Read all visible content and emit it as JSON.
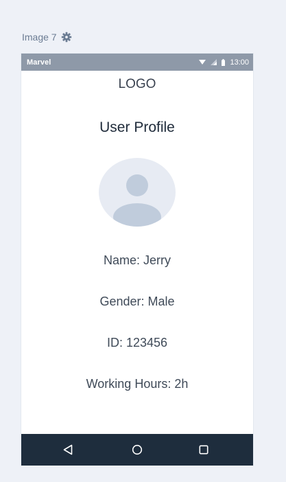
{
  "header": {
    "label": "Image 7",
    "icon": "gear-icon"
  },
  "status_bar": {
    "carrier": "Marvel",
    "time": "13:00",
    "icons": [
      "wifi-icon",
      "signal-icon",
      "battery-icon"
    ]
  },
  "app": {
    "logo": "LOGO",
    "title": "User Profile",
    "avatar_icon": "user-avatar-icon"
  },
  "profile": {
    "name": "Name: Jerry",
    "gender": "Gender: Male",
    "id": "ID: 123456",
    "working_hours": "Working Hours: 2h"
  },
  "nav": {
    "icons": [
      "back-triangle-icon",
      "home-circle-icon",
      "recent-square-icon"
    ]
  },
  "colors": {
    "background": "#eef1f7",
    "status_bar": "#8e99a8",
    "nav_bar": "#1e2d3d",
    "avatar_bg": "#e7ebf3",
    "avatar_fg": "#c0ccdc"
  }
}
